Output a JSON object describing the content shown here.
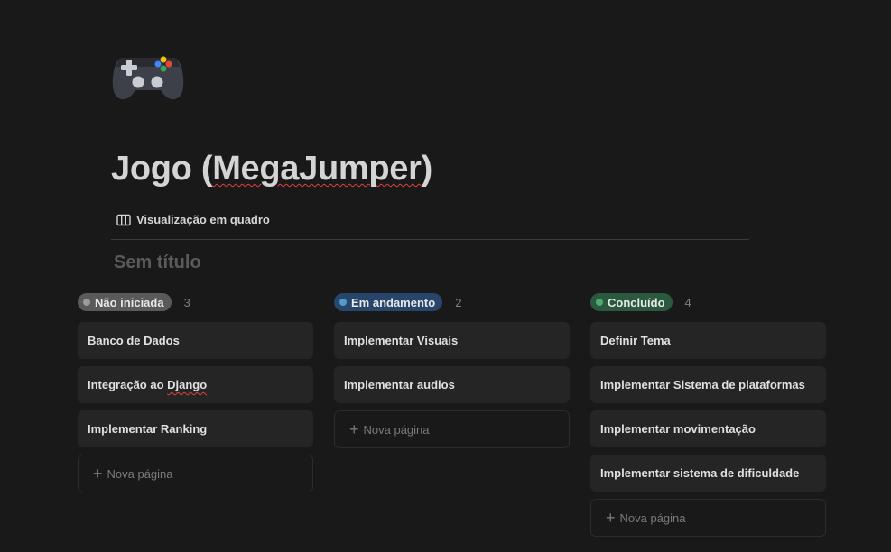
{
  "page": {
    "icon": "gamepad-icon",
    "title_plain": "Jogo (",
    "title_squiggle": "MegaJumper",
    "title_end": ")"
  },
  "view": {
    "icon": "board-columns-icon",
    "label": "Visualização em quadro"
  },
  "board": {
    "title": "Sem título",
    "new_page_label": "Nova página",
    "columns": [
      {
        "status": "Não iniciada",
        "count": "3",
        "pill_color": "#5a5a5a",
        "dot_color": "#9b9b9b",
        "cards": [
          "Banco de Dados",
          "Integração ao Django",
          "Implementar Ranking"
        ]
      },
      {
        "status": "Em andamento",
        "count": "2",
        "pill_color": "#28456c",
        "dot_color": "#529cca",
        "cards": [
          "Implementar Visuais",
          "Implementar audios"
        ]
      },
      {
        "status": "Concluído",
        "count": "4",
        "pill_color": "#2b593f",
        "dot_color": "#4dab6f",
        "cards": [
          "Definir Tema",
          "Implementar Sistema de plataformas",
          "Implementar movimentação",
          "Implementar sistema de dificuldade"
        ]
      }
    ]
  }
}
